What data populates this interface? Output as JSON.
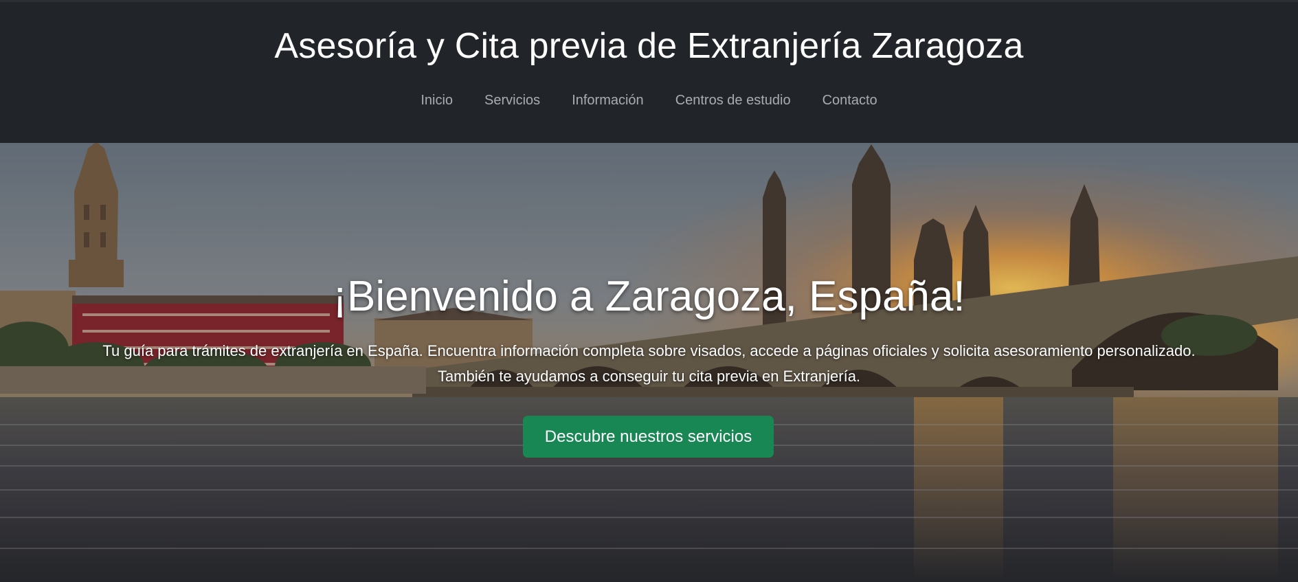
{
  "header": {
    "title": "Asesoría y Cita previa de Extranjería Zaragoza",
    "nav": [
      {
        "label": "Inicio"
      },
      {
        "label": "Servicios"
      },
      {
        "label": "Información"
      },
      {
        "label": "Centros de estudio"
      },
      {
        "label": "Contacto"
      }
    ]
  },
  "hero": {
    "title": "¡Bienvenido a Zaragoza, España!",
    "text": "Tu guía para trámites de extranjería en España. Encuentra información completa sobre visados, accede a páginas oficiales y solicita asesoramiento personalizado. También te ayudamos a conseguir tu cita previa en Extranjería.",
    "button_label": "Descubre nuestros servicios",
    "background_image": "zaragoza-pilar-bridge-sunset-photo"
  },
  "colors": {
    "header_bg": "#212529",
    "nav_link": "#a9adb1",
    "button_bg": "#198754",
    "text": "#ffffff"
  }
}
